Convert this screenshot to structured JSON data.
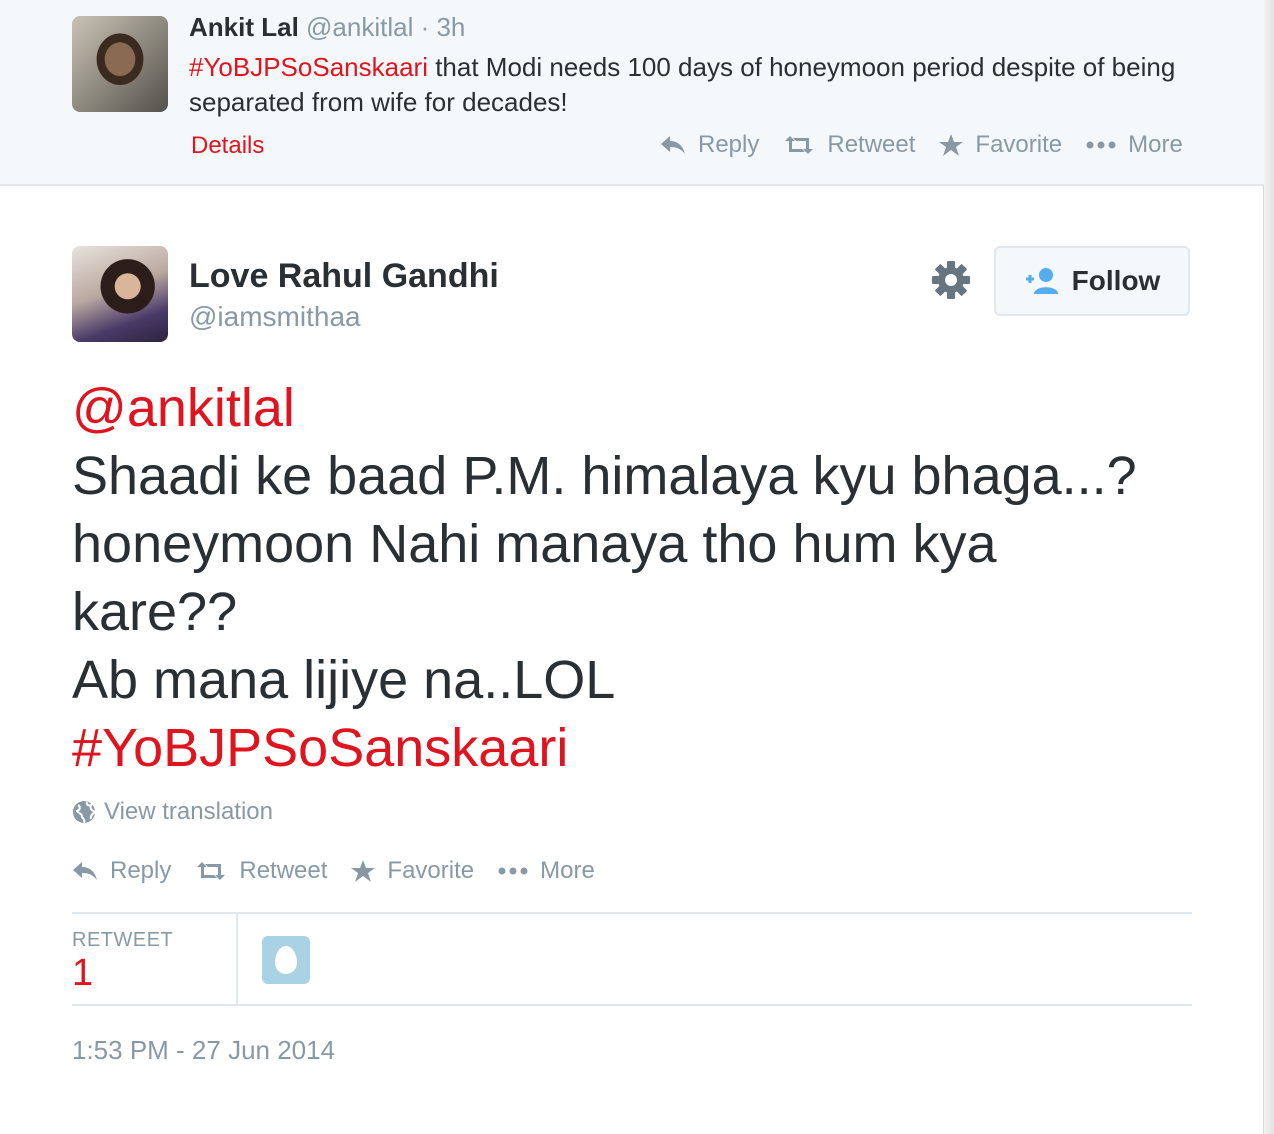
{
  "parent_tweet": {
    "name": "Ankit Lal",
    "handle": "@ankitlal",
    "time": "· 3h",
    "hashtag": "#YoBJPSoSanskaari",
    "text": " that Modi needs 100 days of honeymoon period despite of being separated from wife for decades!",
    "details_label": "Details",
    "actions": {
      "reply": "Reply",
      "retweet": "Retweet",
      "favorite": "Favorite",
      "more": "More"
    }
  },
  "main_tweet": {
    "name": "Love Rahul Gandhi",
    "handle": "@iamsmithaa",
    "follow_label": "Follow",
    "mention": "@ankitlal",
    "lines": [
      "Shaadi ke baad P.M. himalaya kyu bhaga...?",
      "honeymoon Nahi manaya tho hum kya",
      "kare??",
      "Ab mana lijiye na..LOL"
    ],
    "hashtag": "#YoBJPSoSanskaari",
    "translation_label": "View translation",
    "actions": {
      "reply": "Reply",
      "retweet": "Retweet",
      "favorite": "Favorite",
      "more": "More"
    },
    "stats": {
      "retweet_label": "RETWEET",
      "retweet_count": "1"
    },
    "timestamp": "1:53 PM - 27 Jun 2014"
  },
  "icons": {
    "reply": "reply-icon",
    "retweet": "retweet-icon",
    "favorite": "star-icon",
    "more": "more-dots-icon",
    "settings": "gear-icon",
    "follow": "add-user-icon",
    "translate": "globe-icon"
  },
  "colors": {
    "hashtag": "#e0141e",
    "muted": "#8899a6",
    "text": "#292f33",
    "follow_icon": "#55acee"
  }
}
